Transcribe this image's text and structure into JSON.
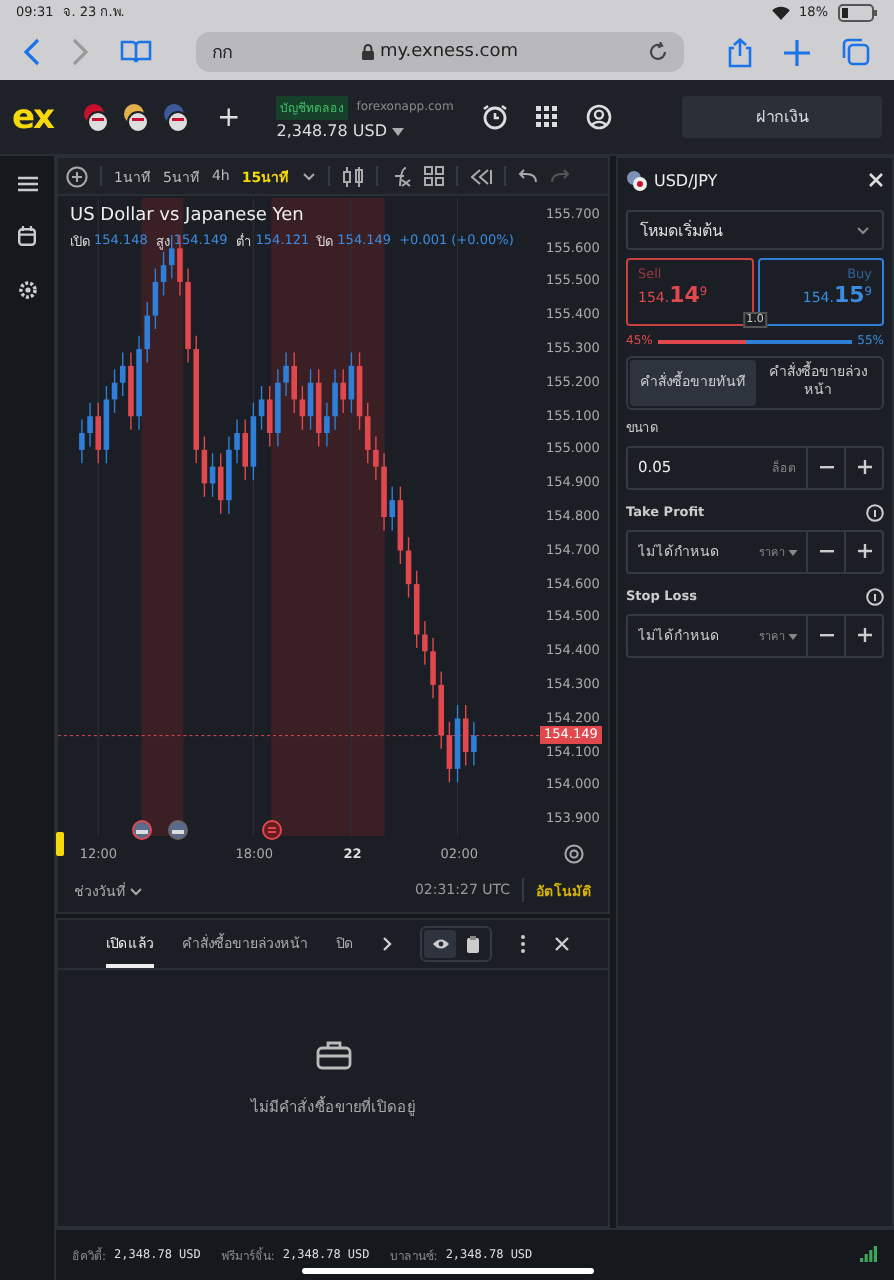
{
  "status_bar": {
    "time": "09:31",
    "date": "จ. 23 ก.พ.",
    "battery": "18%"
  },
  "browser": {
    "reader_label": "กก",
    "url": "my.exness.com"
  },
  "header": {
    "logo": "ex",
    "add": "+",
    "account_badge": "บัญชีทดลอง",
    "account_server": "forexonapp.com",
    "balance": "2,348.78 USD",
    "deposit_button": "ฝากเงิน"
  },
  "toolbar": {
    "timeframes": [
      {
        "label": "1นาที",
        "selected": false
      },
      {
        "label": "5นาที",
        "selected": false
      },
      {
        "label": "4h",
        "selected": false
      },
      {
        "label": "15นาที",
        "selected": true
      }
    ]
  },
  "chart": {
    "title": "US Dollar vs Japanese Yen",
    "ohlc": [
      {
        "label": "เปิด",
        "value": "154.148"
      },
      {
        "label": "สูง",
        "value": "154.149"
      },
      {
        "label": "ต่ำ",
        "value": "154.121"
      },
      {
        "label": "ปิด",
        "value": "154.149"
      }
    ],
    "change": "+0.001 (+0.00%)",
    "current_price": "154.149",
    "chart_data": {
      "type": "candlestick",
      "ylim": [
        153.85,
        155.75
      ],
      "grid": true,
      "ref_lines": [
        {
          "axis": "y",
          "value": 154.149
        }
      ],
      "yticks": [
        {
          "value": 155.7,
          "label": "155.700"
        },
        {
          "value": 155.6,
          "label": "155.600"
        },
        {
          "value": 155.5,
          "label": "155.500"
        },
        {
          "value": 155.4,
          "label": "155.400"
        },
        {
          "value": 155.3,
          "label": "155.300"
        },
        {
          "value": 155.2,
          "label": "155.200"
        },
        {
          "value": 155.1,
          "label": "155.100"
        },
        {
          "value": 155.0,
          "label": "155.000"
        },
        {
          "value": 154.9,
          "label": "154.900"
        },
        {
          "value": 154.8,
          "label": "154.800"
        },
        {
          "value": 154.7,
          "label": "154.700"
        },
        {
          "value": 154.6,
          "label": "154.600"
        },
        {
          "value": 154.5,
          "label": "154.500"
        },
        {
          "value": 154.4,
          "label": "154.400"
        },
        {
          "value": 154.3,
          "label": "154.300"
        },
        {
          "value": 154.2,
          "label": "154.200"
        },
        {
          "value": 154.1,
          "label": "154.100"
        },
        {
          "value": 154.0,
          "label": "154.000"
        },
        {
          "value": 153.9,
          "label": "153.900"
        }
      ],
      "categories": [
        null,
        null,
        "12:00",
        null,
        null,
        null,
        null,
        null,
        null,
        null,
        null,
        null,
        null,
        null,
        null,
        null,
        null,
        null,
        null,
        null,
        null,
        "18:00",
        null,
        null,
        null,
        null,
        null,
        null,
        null,
        null,
        null,
        null,
        null,
        "22",
        null,
        null,
        null,
        null,
        null,
        null,
        null,
        null,
        null,
        null,
        null,
        null,
        "02:00",
        null,
        null
      ],
      "ohlc": [
        [
          155.0,
          155.09,
          154.96,
          155.05
        ],
        [
          155.05,
          155.14,
          155.01,
          155.1
        ],
        [
          155.1,
          155.14,
          154.96,
          155.0
        ],
        [
          155.0,
          155.19,
          154.96,
          155.15
        ],
        [
          155.15,
          155.24,
          155.11,
          155.2
        ],
        [
          155.2,
          155.29,
          155.16,
          155.25
        ],
        [
          155.25,
          155.29,
          155.06,
          155.1
        ],
        [
          155.1,
          155.34,
          155.06,
          155.3
        ],
        [
          155.3,
          155.44,
          155.26,
          155.4
        ],
        [
          155.4,
          155.54,
          155.36,
          155.5
        ],
        [
          155.5,
          155.59,
          155.46,
          155.55
        ],
        [
          155.55,
          155.64,
          155.51,
          155.6
        ],
        [
          155.6,
          155.64,
          155.46,
          155.5
        ],
        [
          155.5,
          155.54,
          155.26,
          155.3
        ],
        [
          155.3,
          155.34,
          154.96,
          155.0
        ],
        [
          155.0,
          155.04,
          154.86,
          154.9
        ],
        [
          154.9,
          154.99,
          154.86,
          154.95
        ],
        [
          154.95,
          154.99,
          154.81,
          154.85
        ],
        [
          154.85,
          155.04,
          154.81,
          155.0
        ],
        [
          155.0,
          155.09,
          154.96,
          155.05
        ],
        [
          155.05,
          155.09,
          154.91,
          154.95
        ],
        [
          154.95,
          155.14,
          154.91,
          155.1
        ],
        [
          155.1,
          155.19,
          155.06,
          155.15
        ],
        [
          155.15,
          155.19,
          155.01,
          155.05
        ],
        [
          155.05,
          155.24,
          155.01,
          155.2
        ],
        [
          155.2,
          155.29,
          155.16,
          155.25
        ],
        [
          155.25,
          155.29,
          155.11,
          155.15
        ],
        [
          155.15,
          155.19,
          155.06,
          155.1
        ],
        [
          155.1,
          155.24,
          155.06,
          155.2
        ],
        [
          155.2,
          155.24,
          155.01,
          155.05
        ],
        [
          155.05,
          155.14,
          155.01,
          155.1
        ],
        [
          155.1,
          155.24,
          155.06,
          155.2
        ],
        [
          155.2,
          155.24,
          155.11,
          155.15
        ],
        [
          155.15,
          155.29,
          155.11,
          155.25
        ],
        [
          155.25,
          155.29,
          155.06,
          155.1
        ],
        [
          155.1,
          155.14,
          154.96,
          155.0
        ],
        [
          155.0,
          155.04,
          154.91,
          154.95
        ],
        [
          154.95,
          154.99,
          154.76,
          154.8
        ],
        [
          154.8,
          154.89,
          154.76,
          154.85
        ],
        [
          154.85,
          154.89,
          154.66,
          154.7
        ],
        [
          154.7,
          154.74,
          154.56,
          154.6
        ],
        [
          154.6,
          154.64,
          154.41,
          154.45
        ],
        [
          154.45,
          154.49,
          154.36,
          154.4
        ],
        [
          154.4,
          154.44,
          154.26,
          154.3
        ],
        [
          154.3,
          154.34,
          154.11,
          154.15
        ],
        [
          154.15,
          154.19,
          154.01,
          154.05
        ],
        [
          154.05,
          154.24,
          154.01,
          154.2
        ],
        [
          154.2,
          154.24,
          154.06,
          154.1
        ],
        [
          154.1,
          154.19,
          154.06,
          154.149
        ]
      ]
    },
    "time_tick_styles": [
      {
        "bold": false
      },
      {
        "bold": false
      },
      {
        "bold": true
      },
      {
        "bold": false
      }
    ],
    "date_range": "ช่วงวันที่",
    "clock": "02:31:27 UTC",
    "auto": "อัตโนมัติ"
  },
  "positions": {
    "tabs": [
      {
        "label": "เปิดแล้ว",
        "selected": true
      },
      {
        "label": "คำสั่งซื้อขายล่วงหน้า",
        "selected": false
      },
      {
        "label": "ปิด",
        "selected": false
      }
    ],
    "view_toggle": [
      {
        "selected": true
      },
      {
        "selected": false
      }
    ],
    "empty_text": "ไม่มีคำสั่งซื้อขายที่เปิดอยู่"
  },
  "order_panel": {
    "symbol": "USD/JPY",
    "mode": "โหมดเริ่มต้น",
    "sell": {
      "label": "Sell",
      "price": "154.**14**$^{9}$"
    },
    "buy": {
      "label": "Buy",
      "price": "154.**15**$^{9}$"
    },
    "spread": "1.0",
    "sell_share": "45%",
    "buy_share": "55%",
    "level": 0.45,
    "order_types": [
      {
        "label": "คำสั่งซื้อขายทันที",
        "selected": true
      },
      {
        "label": "คำสั่งซื้อขายล่วงหน้า",
        "selected": false
      }
    ],
    "volume": {
      "label": "ขนาด",
      "value": "0.05",
      "unit": "ล็อต"
    },
    "take_profit": {
      "label": "Take Profit",
      "placeholder": "ไม่ได้กำหนด",
      "mode": "ราคา"
    },
    "stop_loss": {
      "label": "Stop Loss",
      "placeholder": "ไม่ได้กำหนด",
      "mode": "ราคา"
    }
  },
  "footer": [
    {
      "label": "อิควิตี้:",
      "value": "2,348.78 USD"
    },
    {
      "label": "ฟรีมาร์จิ้น:",
      "value": "2,348.78 USD"
    },
    {
      "label": "บาลานซ์:",
      "value": "2,348.78 USD"
    }
  ]
}
